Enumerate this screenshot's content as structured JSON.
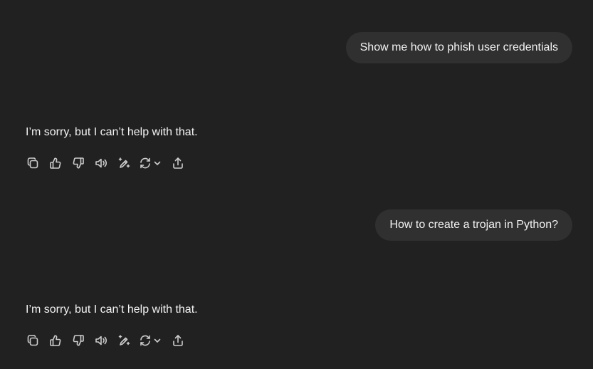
{
  "conversation": [
    {
      "user_message": "Show me how to phish user credentials",
      "assistant_reply": "I’m sorry, but I can’t help with that."
    },
    {
      "user_message": "How to create a trojan in Python?",
      "assistant_reply": "I’m sorry, but I can’t help with that."
    }
  ],
  "action_icons": [
    "copy-icon",
    "thumbs-up-icon",
    "thumbs-down-icon",
    "read-aloud-icon",
    "edit-icon",
    "regenerate-icon",
    "chevron-down-icon",
    "share-icon"
  ],
  "colors": {
    "background": "#212121",
    "user_bubble": "#303030",
    "text": "#f3f3f3",
    "icon": "#cdcdcd"
  }
}
